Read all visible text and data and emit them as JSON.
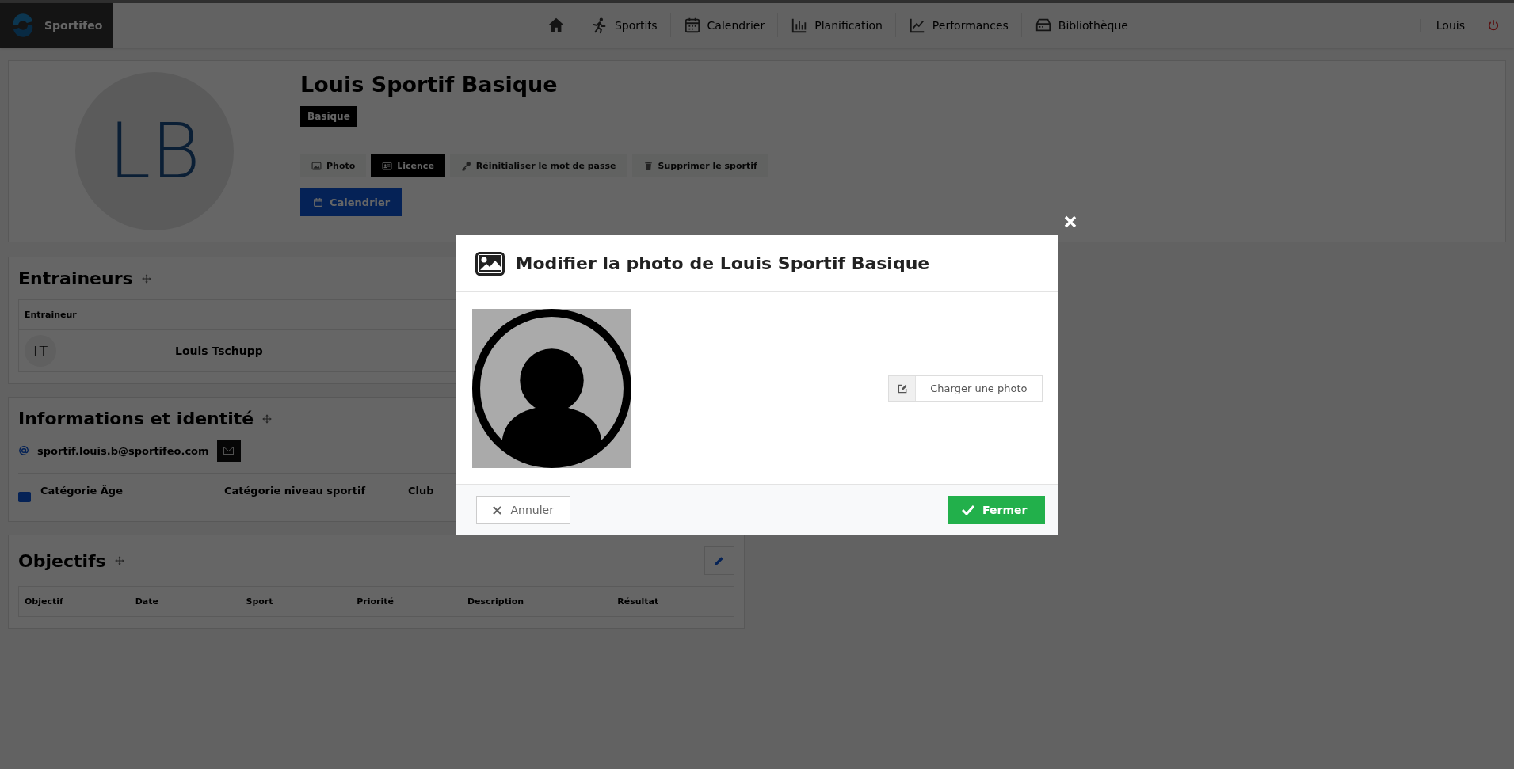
{
  "navbar": {
    "brand": "Sportifeo",
    "items": [
      {
        "kind": "home"
      },
      {
        "kind": "runner",
        "label": "Sportifs"
      },
      {
        "kind": "calendar",
        "label": "Calendrier"
      },
      {
        "kind": "bars",
        "label": "Planification"
      },
      {
        "kind": "chart",
        "label": "Performances"
      },
      {
        "kind": "box",
        "label": "Bibliothèque"
      }
    ],
    "user": "Louis"
  },
  "profile": {
    "initials": "LB",
    "name": "Louis Sportif Basique",
    "badge": "Basique",
    "actions": [
      {
        "kind": "image",
        "label": "Photo",
        "selected": false
      },
      {
        "kind": "card",
        "label": "Licence",
        "selected": true
      },
      {
        "kind": "key",
        "label": "Réinitialiser le mot de passe",
        "selected": false
      },
      {
        "kind": "trash",
        "label": "Supprimer le sportif",
        "selected": false
      }
    ],
    "calendar_button": "Calendrier"
  },
  "coaches": {
    "title": "Entraineurs",
    "column": "Entraineur",
    "rows": [
      {
        "initials": "LT",
        "name": "Louis Tschupp"
      }
    ]
  },
  "identity": {
    "title": "Informations et identité",
    "email": "sportif.louis.b@sportifeo.com",
    "fields": [
      "Catégorie Âge",
      "Catégorie niveau sportif",
      "Club"
    ]
  },
  "goals": {
    "title": "Objectifs",
    "columns": [
      "Objectif",
      "Date",
      "Sport",
      "Priorité",
      "Description",
      "Résultat"
    ]
  },
  "modal": {
    "title": "Modifier la photo de Louis Sportif Basique",
    "upload": "Charger une photo",
    "cancel": "Annuler",
    "confirm": "Fermer"
  }
}
